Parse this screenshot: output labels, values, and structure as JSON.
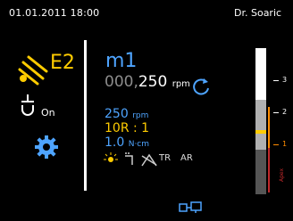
{
  "status": {
    "datetime": "01.01.2011 18:00",
    "user": "Dr. Soaric"
  },
  "sidebar": {
    "program_label": "E2",
    "light_state": "On"
  },
  "main": {
    "motor_id": "m1",
    "speed_leading": "000,",
    "speed_value": "250",
    "speed_unit": "rpm",
    "set_speed_value": "250",
    "set_speed_unit": "rpm",
    "ratio": "10R : 1",
    "torque_value": "1.0",
    "torque_unit": "N·cm",
    "mode_icons": [
      "TR",
      "AR"
    ]
  },
  "apex_scale": {
    "labels": [
      "3",
      "2",
      "1"
    ],
    "apex_label": "Apex"
  },
  "colors": {
    "accent_blue": "#4ea4ff",
    "accent_yellow": "#ffcc00",
    "warning_orange": "#ff8c00",
    "apex_red": "#c0282a"
  }
}
